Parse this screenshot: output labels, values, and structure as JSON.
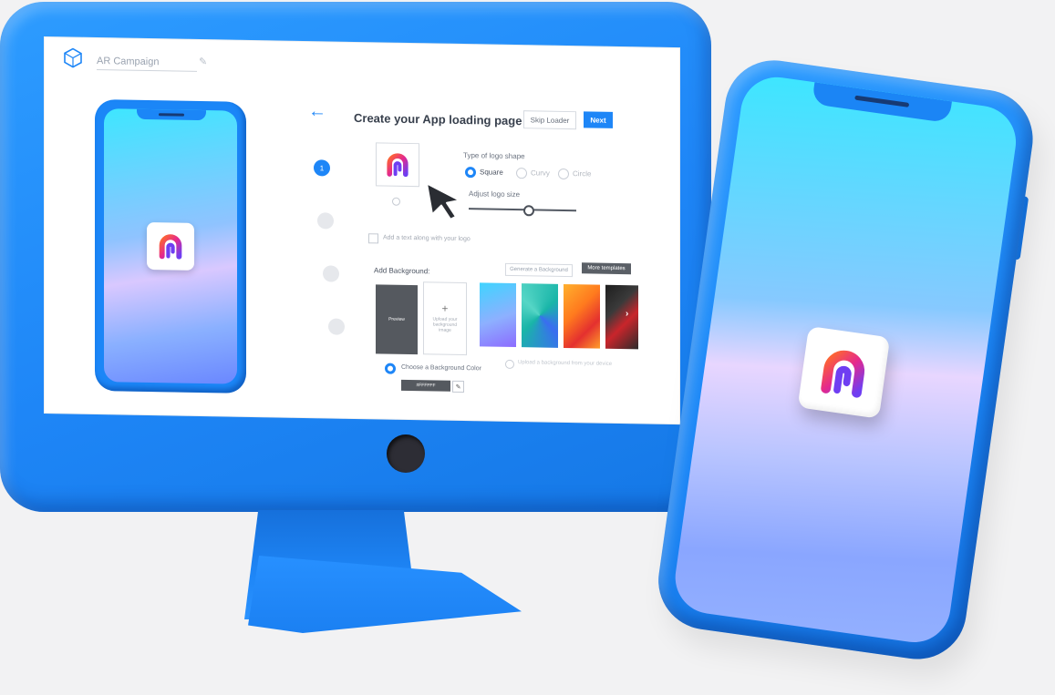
{
  "app": {
    "campaign_name": "AR Campaign"
  },
  "page": {
    "title": "Create your App loading page",
    "skip_label": "Skip Loader",
    "next_label": "Next"
  },
  "stepper": {
    "steps": [
      {
        "label": "1",
        "state": "active"
      },
      {
        "label": "",
        "state": "inactive"
      },
      {
        "label": "",
        "state": "inactive"
      },
      {
        "label": "",
        "state": "inactive"
      }
    ]
  },
  "logo_section": {
    "shape_label": "Type of logo shape",
    "shape_options": [
      "Square",
      "Curvy",
      "Circle"
    ],
    "selected_shape": "Square",
    "size_label": "Adjust logo size",
    "size_value": 0.55,
    "text_checkbox_label": "Add a text along with your logo"
  },
  "background_section": {
    "label": "Add Background:",
    "generate_label": "Generate a Background",
    "more_templates_label": "More templates",
    "preview_label": "Preview",
    "upload_label": "Upload your background image",
    "choose_color_label": "Choose a Background Color",
    "color_value": "#FFFFFF",
    "upload_option_label": "Upload a background from your device",
    "thumbnails": [
      {
        "name": "gradient-blue-purple",
        "colors": [
          "#3fd4ff",
          "#8c6bff"
        ]
      },
      {
        "name": "teal-triangles",
        "colors": [
          "#19b5a8",
          "#3a6df0"
        ]
      },
      {
        "name": "orange-red-facets",
        "colors": [
          "#ff8a1e",
          "#e4302f"
        ]
      },
      {
        "name": "dark-red-facets",
        "colors": [
          "#2b2b2b",
          "#c9252b"
        ]
      }
    ]
  },
  "colors": {
    "device_blue": "#1e86f7",
    "accent": "#1e86f7",
    "logo_gradient": [
      "#ff5a3c",
      "#e0288f",
      "#7b3df0"
    ]
  }
}
